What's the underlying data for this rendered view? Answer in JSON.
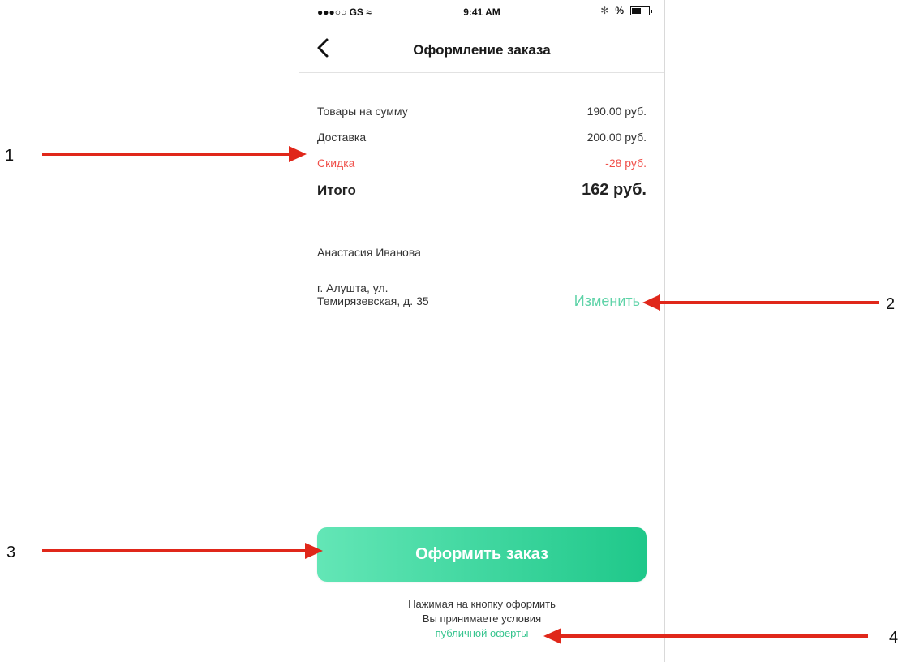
{
  "status_bar": {
    "carrier": "●●●○○ GS",
    "wifi": "≈",
    "time": "9:41 AM",
    "bluetooth": "✻",
    "percent": "%"
  },
  "nav": {
    "title": "Оформление заказа",
    "back_icon": "chevron-left-icon"
  },
  "summary": {
    "goods": {
      "label": "Товары на сумму",
      "value": "190.00 руб."
    },
    "delivery": {
      "label": "Доставка",
      "value": "200.00 руб."
    },
    "discount": {
      "label": "Скидка",
      "value": "-28 руб."
    },
    "total": {
      "label": "Итого",
      "value": "162 руб."
    }
  },
  "customer": {
    "name": "Анастасия Иванова",
    "address_line1": "г. Алушта, ул.",
    "address_line2": "Темирязевская, д. 35",
    "change_label": "Изменить"
  },
  "order_button": {
    "label": "Оформить заказ"
  },
  "terms": {
    "line1": "Нажимая на кнопку оформить",
    "line2": "Вы принимаете условия",
    "link": "публичной оферты"
  },
  "callouts": [
    "1",
    "2",
    "3",
    "4"
  ],
  "colors": {
    "accent": "#1fc88a",
    "link": "#5fd3a8",
    "discount": "#f0504a",
    "arrow": "#e0271a"
  }
}
